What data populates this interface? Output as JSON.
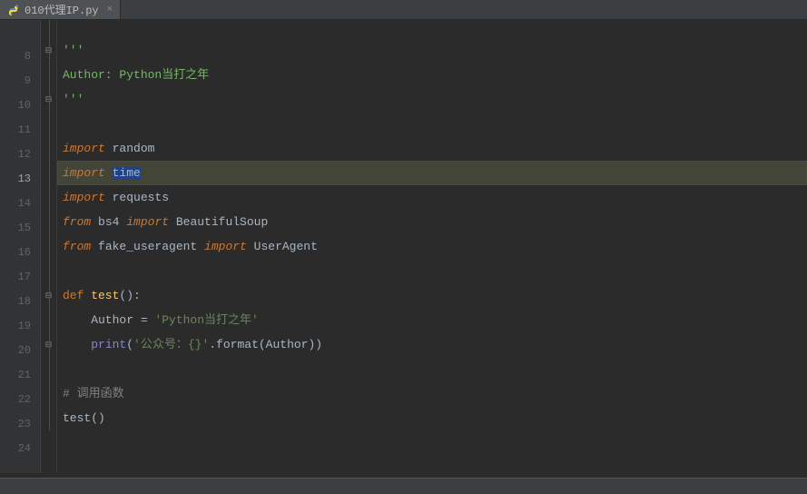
{
  "tab": {
    "filename": "010代理IP.py",
    "close_glyph": "×"
  },
  "gutter": {
    "lines": [
      "",
      "8",
      "9",
      "10",
      "11",
      "12",
      "13",
      "14",
      "15",
      "16",
      "17",
      "18",
      "19",
      "20",
      "21",
      "22",
      "23",
      "24"
    ]
  },
  "current_line_index": 6,
  "code": {
    "l0": "",
    "l1_doc": "'''",
    "l2_a": "Author: Python",
    "l2_b": "当打之年",
    "l3_doc": "'''",
    "l5_kw": "import",
    "l5_mod": " random",
    "l6_kw": "import",
    "l6_mod_a": " ",
    "l6_mod_sel": "time",
    "l7_kw": "import",
    "l7_mod": " requests",
    "l8_from": "from",
    "l8_pkg": " bs4 ",
    "l8_imp": "import",
    "l8_sym": " BeautifulSoup",
    "l9_from": "from",
    "l9_pkg": " fake_useragent ",
    "l9_imp": "import",
    "l9_sym": " UserAgent",
    "l11_def": "def",
    "l11_name": " test",
    "l11_paren": "():",
    "l12_a": "    Author = ",
    "l12_s": "'Python当打之年'",
    "l13_a": "    ",
    "l13_fn": "print",
    "l13_b": "(",
    "l13_s": "'公众号：{}'",
    "l13_c": ".format(Author))",
    "l15_com": "# 调用函数",
    "l16_a": "test()"
  }
}
